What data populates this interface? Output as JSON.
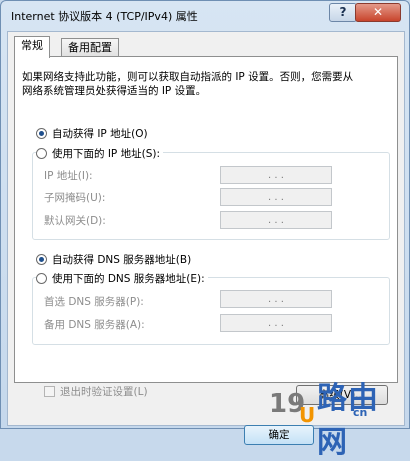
{
  "window": {
    "title": "Internet 协议版本 4 (TCP/IPv4) 属性",
    "help_label": "?",
    "close_label": "✕"
  },
  "tabs": [
    {
      "label": "常规",
      "active": true
    },
    {
      "label": "备用配置",
      "active": false
    }
  ],
  "description": "如果网络支持此功能，则可以获取自动指派的 IP 设置。否则，您需要从网络系统管理员处获得适当的 IP 设置。",
  "ip_section": {
    "auto_label": "自动获得 IP 地址(O)",
    "manual_label": "使用下面的 IP 地址(S):",
    "selected": "auto",
    "fields": [
      {
        "label": "IP 地址(I):",
        "value": ". . ."
      },
      {
        "label": "子网掩码(U):",
        "value": ". . ."
      },
      {
        "label": "默认网关(D):",
        "value": ". . ."
      }
    ]
  },
  "dns_section": {
    "auto_label": "自动获得 DNS 服务器地址(B)",
    "manual_label": "使用下面的 DNS 服务器地址(E):",
    "selected": "auto",
    "fields": [
      {
        "label": "首选 DNS 服务器(P):",
        "value": ". . ."
      },
      {
        "label": "备用 DNS 服务器(A):",
        "value": ". . ."
      }
    ]
  },
  "validate_checkbox": {
    "label": "退出时验证设置(L)",
    "checked": false
  },
  "buttons": {
    "advanced": "高级(V)...",
    "ok": "确定"
  },
  "watermark": {
    "part1": "19",
    "part2": "U",
    "brand": "路由网",
    "domain": "cn"
  }
}
